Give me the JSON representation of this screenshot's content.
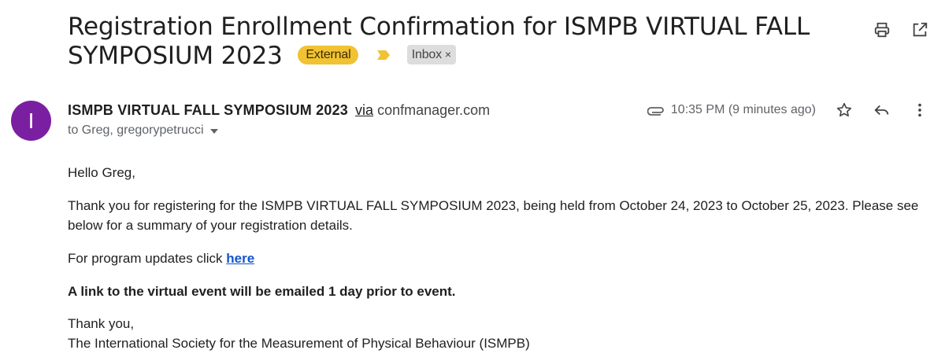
{
  "email": {
    "subject": "Registration Enrollment Confirmation for ISMPB VIRTUAL FALL SYMPOSIUM 2023",
    "labels": {
      "external": "External",
      "inbox": "Inbox",
      "inbox_remove": "×"
    },
    "sender": {
      "avatar_letter": "I",
      "avatar_color": "#7b1fa2",
      "name": "ISMPB VIRTUAL FALL SYMPOSIUM 2023",
      "via": "via",
      "via_domain": "confmanager.com",
      "to": "to Greg, gregorypetrucci"
    },
    "timestamp": "10:35 PM (9 minutes ago)",
    "icons": [
      "print-icon",
      "open-in-new-icon",
      "attachment-icon",
      "star-icon",
      "reply-icon",
      "more-icon"
    ],
    "body": {
      "greeting": "Hello Greg,",
      "thanks": "Thank you for registering for the ISMPB VIRTUAL FALL SYMPOSIUM 2023, being held from October 24, 2023 to October 25, 2023. Please see below for a summary of your registration details.",
      "updates_prefix": "For program updates click ",
      "updates_link": "here",
      "link_notice": "A link to the virtual event will be emailed 1 day prior to event.",
      "closing": "Thank you,",
      "signature": "The International Society for the Measurement of Physical Behaviour (ISMPB)"
    }
  },
  "colors": {
    "external_badge": "#f1c232",
    "importance_marker": "#f1c232",
    "link": "#1155cc"
  }
}
